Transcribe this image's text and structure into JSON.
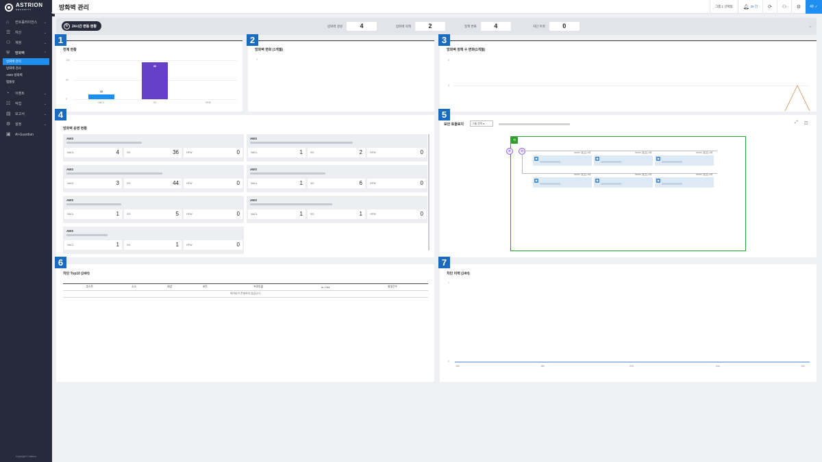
{
  "brand": {
    "name": "ASTRION",
    "tagline": "SECURITY"
  },
  "sidebar": {
    "items": [
      {
        "label": "컨트롤러이언스",
        "icon": "home-icon"
      },
      {
        "label": "자산",
        "icon": "database-icon"
      },
      {
        "label": "계정",
        "icon": "users-icon"
      },
      {
        "label": "방화벽",
        "icon": "shield-icon"
      },
      {
        "label": "이벤트",
        "icon": "event-icon"
      },
      {
        "label": "작업",
        "icon": "task-icon"
      },
      {
        "label": "보고서",
        "icon": "report-icon"
      },
      {
        "label": "설정",
        "icon": "gear-icon"
      },
      {
        "label": "AI-Guardian",
        "icon": "ai-icon"
      }
    ],
    "subitems": [
      "방화벽 관리",
      "방화벽 검사",
      "AWS 방화벽",
      "템플릿"
    ],
    "copyright": "Copyright © Astrion"
  },
  "header": {
    "title": "방화벽 관리",
    "group": "그룹 1 선택됨",
    "alerts": "25 건",
    "user": "49"
  },
  "status": {
    "pill": "24시간 변동 현황",
    "stats": [
      {
        "label": "방화벽 생성",
        "value": "4"
      },
      {
        "label": "방화벽 삭제",
        "value": "2"
      },
      {
        "label": "정책 변화",
        "value": "4"
      },
      {
        "label": "차단 이력",
        "value": "0"
      }
    ]
  },
  "badges": [
    "1",
    "2",
    "3",
    "4",
    "5",
    "6",
    "7"
  ],
  "panels": {
    "overall": {
      "title": "전체 현황"
    },
    "fw_change": {
      "title": "방화벽 변화 (1개월)",
      "ytick": "1"
    },
    "policy_change": {
      "title": "방화벽 정책 수 변화(1개월)",
      "yticks": [
        "3",
        "2"
      ]
    },
    "ops": {
      "title": "방화벽 운영 현황"
    },
    "topology": {
      "title": "보안 토폴로지",
      "select": "그룹 선택",
      "node_label": "50.0%, 중요도 0개"
    },
    "top10": {
      "title": "차단 Top10 (24H)",
      "columns": [
        "호스트",
        "소스",
        "대상",
        "포트",
        "프로토콜",
        "In / Out",
        "발생건수"
      ],
      "empty": "데이터가 존재하지 않습니다."
    },
    "block_history": {
      "title": "차단 이력 (24H)",
      "yticks": [
        "1",
        "0"
      ],
      "xticks": [
        "15h",
        "18h",
        "22h",
        "04h",
        "10h"
      ]
    }
  },
  "chart_data": [
    {
      "type": "bar",
      "title": "전체 현황",
      "categories": [
        "NACL",
        "SG",
        "HFW"
      ],
      "values": [
        12,
        95,
        0
      ],
      "ylim": [
        0,
        100
      ],
      "yticks": [
        "100",
        "50",
        "0"
      ],
      "colors": [
        "#1f8ef1",
        "#6440c7",
        "#cccccc"
      ]
    },
    {
      "type": "line",
      "title": "방화벽 정책 수 변화(1개월)",
      "series": [
        {
          "values": [
            1,
            1,
            1,
            1,
            1,
            1,
            1,
            1,
            1,
            1,
            1,
            1,
            1,
            1,
            1,
            1,
            1,
            1,
            1,
            1,
            1,
            1,
            1,
            1,
            1,
            1,
            1,
            1,
            2,
            1
          ]
        }
      ],
      "ylim": [
        1,
        3
      ],
      "color": "#e0a36b"
    },
    {
      "type": "line",
      "title": "차단 이력 (24H)",
      "series": [
        {
          "values": [
            0,
            0,
            0,
            0,
            0
          ]
        }
      ],
      "ylim": [
        0,
        1
      ],
      "color": "#3a86d1"
    }
  ],
  "ops_cards": [
    {
      "provider": "AWS",
      "nacl": "4",
      "sg": "36",
      "hfw": "0"
    },
    {
      "provider": "AWS",
      "nacl": "1",
      "sg": "2",
      "hfw": "0"
    },
    {
      "provider": "AWS",
      "nacl": "3",
      "sg": "44",
      "hfw": "0"
    },
    {
      "provider": "AWS",
      "nacl": "1",
      "sg": "6",
      "hfw": "0"
    },
    {
      "provider": "AWS",
      "nacl": "1",
      "sg": "5",
      "hfw": "0"
    },
    {
      "provider": "AWS",
      "nacl": "1",
      "sg": "1",
      "hfw": "0"
    },
    {
      "provider": "AWS",
      "nacl": "1",
      "sg": "1",
      "hfw": "0"
    }
  ],
  "ops_labels": {
    "nacl": "NACL",
    "sg": "SG",
    "hfw": "HFW"
  }
}
